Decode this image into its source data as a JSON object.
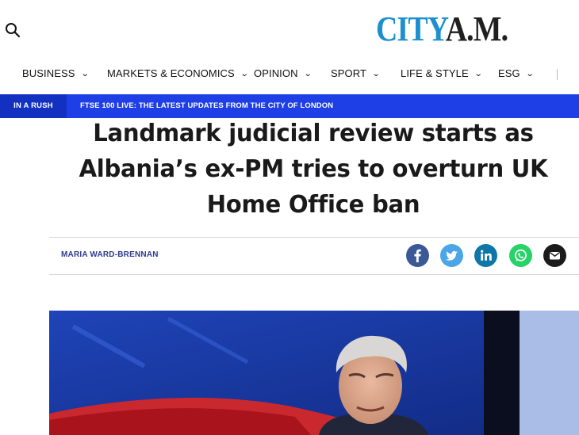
{
  "header": {
    "logo_city": "CITY",
    "logo_am": "A.M."
  },
  "nav": {
    "items": [
      {
        "label": "BUSINESS",
        "chevron": "⌄"
      },
      {
        "label": "MARKETS & ECONOMICS",
        "chevron": "⌄"
      },
      {
        "label": "OPINION",
        "chevron": "⌄"
      },
      {
        "label": "SPORT",
        "chevron": "⌄"
      },
      {
        "label": "LIFE & STYLE",
        "chevron": "⌄"
      },
      {
        "label": "ESG",
        "chevron": "⌄"
      }
    ]
  },
  "in_a_rush": {
    "label": "IN A RUSH",
    "link": "FTSE 100 LIVE: THE LATEST UPDATES FROM THE CITY OF LONDON"
  },
  "article": {
    "headline_line1": "Landmark judicial review starts as",
    "headline_line2": "Albania’s ex-PM tries to overturn UK",
    "headline_line3": "Home Office ban",
    "author": "MARIA WARD-BRENNAN"
  },
  "share": {
    "icons": [
      "facebook-icon",
      "twitter-icon",
      "linkedin-icon",
      "whatsapp-icon",
      "email-icon"
    ],
    "colors": {
      "facebook": "#3b5998",
      "twitter": "#4aa6e6",
      "linkedin": "#0e76a8",
      "whatsapp": "#25d366",
      "email": "#1b1b1b"
    }
  },
  "colors": {
    "logo_city": "#1d8fd0",
    "rush_bar": "#1e3ee6",
    "author": "#2f3a8f"
  }
}
